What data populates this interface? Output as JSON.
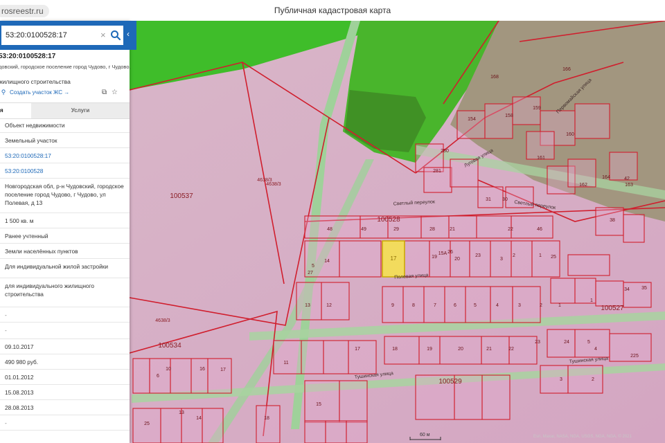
{
  "browser": {
    "url": "rosreestr.ru",
    "title": "Публичная кадастровая карта"
  },
  "search": {
    "value": "53:20:0100528:17",
    "clear": "×"
  },
  "parcel": {
    "number": "53:20:0100528:17",
    "address_line": "довский, городское поселение город Чудово, г Чудово,",
    "use_line": "жилищного строительства",
    "create_link": "Создать участок ЖС →"
  },
  "tabs": {
    "info": "я",
    "services": "Услуги"
  },
  "rows": [
    "Объект недвижимости",
    "Земельный участок",
    "53:20:0100528:17",
    "53:20:0100528",
    "Новгородская обл, р-н Чудовский, городское поселение город Чудово, г Чудово, ул Полевая, д 13",
    "1 500 кв. м",
    "Ранее учтенный",
    "Земли населённых пунктов",
    "Для индивидуальной жилой застройки",
    "для индивидуального жилищного строительства",
    "-",
    "-",
    "09.10.2017",
    "490 980 руб.",
    "01.01.2012",
    "15.08.2013",
    "28.08.2013",
    "-"
  ],
  "map": {
    "blocks": [
      "100537",
      "100528",
      "100534",
      "100527",
      "100529",
      "4638/3",
      "4638/3",
      "4638/3"
    ],
    "streets": [
      "Полевая улица",
      "Светлый переулок",
      "Светлый переулок",
      "Луговая улица",
      "Тушинская улица",
      "Тушинская улица",
      "Первомайская улица"
    ],
    "selected": "17",
    "parcel_numbers": [
      "48",
      "49",
      "29",
      "28",
      "21",
      "22",
      "46",
      "26",
      "5",
      "14",
      "27",
      "19",
      "15A",
      "20",
      "23",
      "1",
      "2",
      "3",
      "25",
      "13",
      "12",
      "9",
      "8",
      "7",
      "6",
      "5",
      "4",
      "3",
      "2",
      "1",
      "17",
      "18",
      "19",
      "20",
      "21",
      "22",
      "23",
      "24",
      "11",
      "6",
      "16",
      "10",
      "17",
      "4",
      "5",
      "25",
      "15",
      "18",
      "13",
      "14",
      "1",
      "2",
      "3",
      "225",
      "34",
      "35",
      "280",
      "281",
      "31",
      "30",
      "38",
      "42",
      "154",
      "158",
      "159",
      "160",
      "161",
      "162",
      "163",
      "164",
      "166",
      "168",
      "150"
    ],
    "scale": "60 м",
    "credits": "Esri, Maxar, NASA, NGA, USGS, NGA, NGA, © 2021"
  },
  "colors": {
    "accent": "#1e69b8",
    "parcel_border": "#d01e2d",
    "parcel_fill": "#e6a9ce",
    "selected_fill": "#f7e34a",
    "green": "#3fbd2a"
  }
}
